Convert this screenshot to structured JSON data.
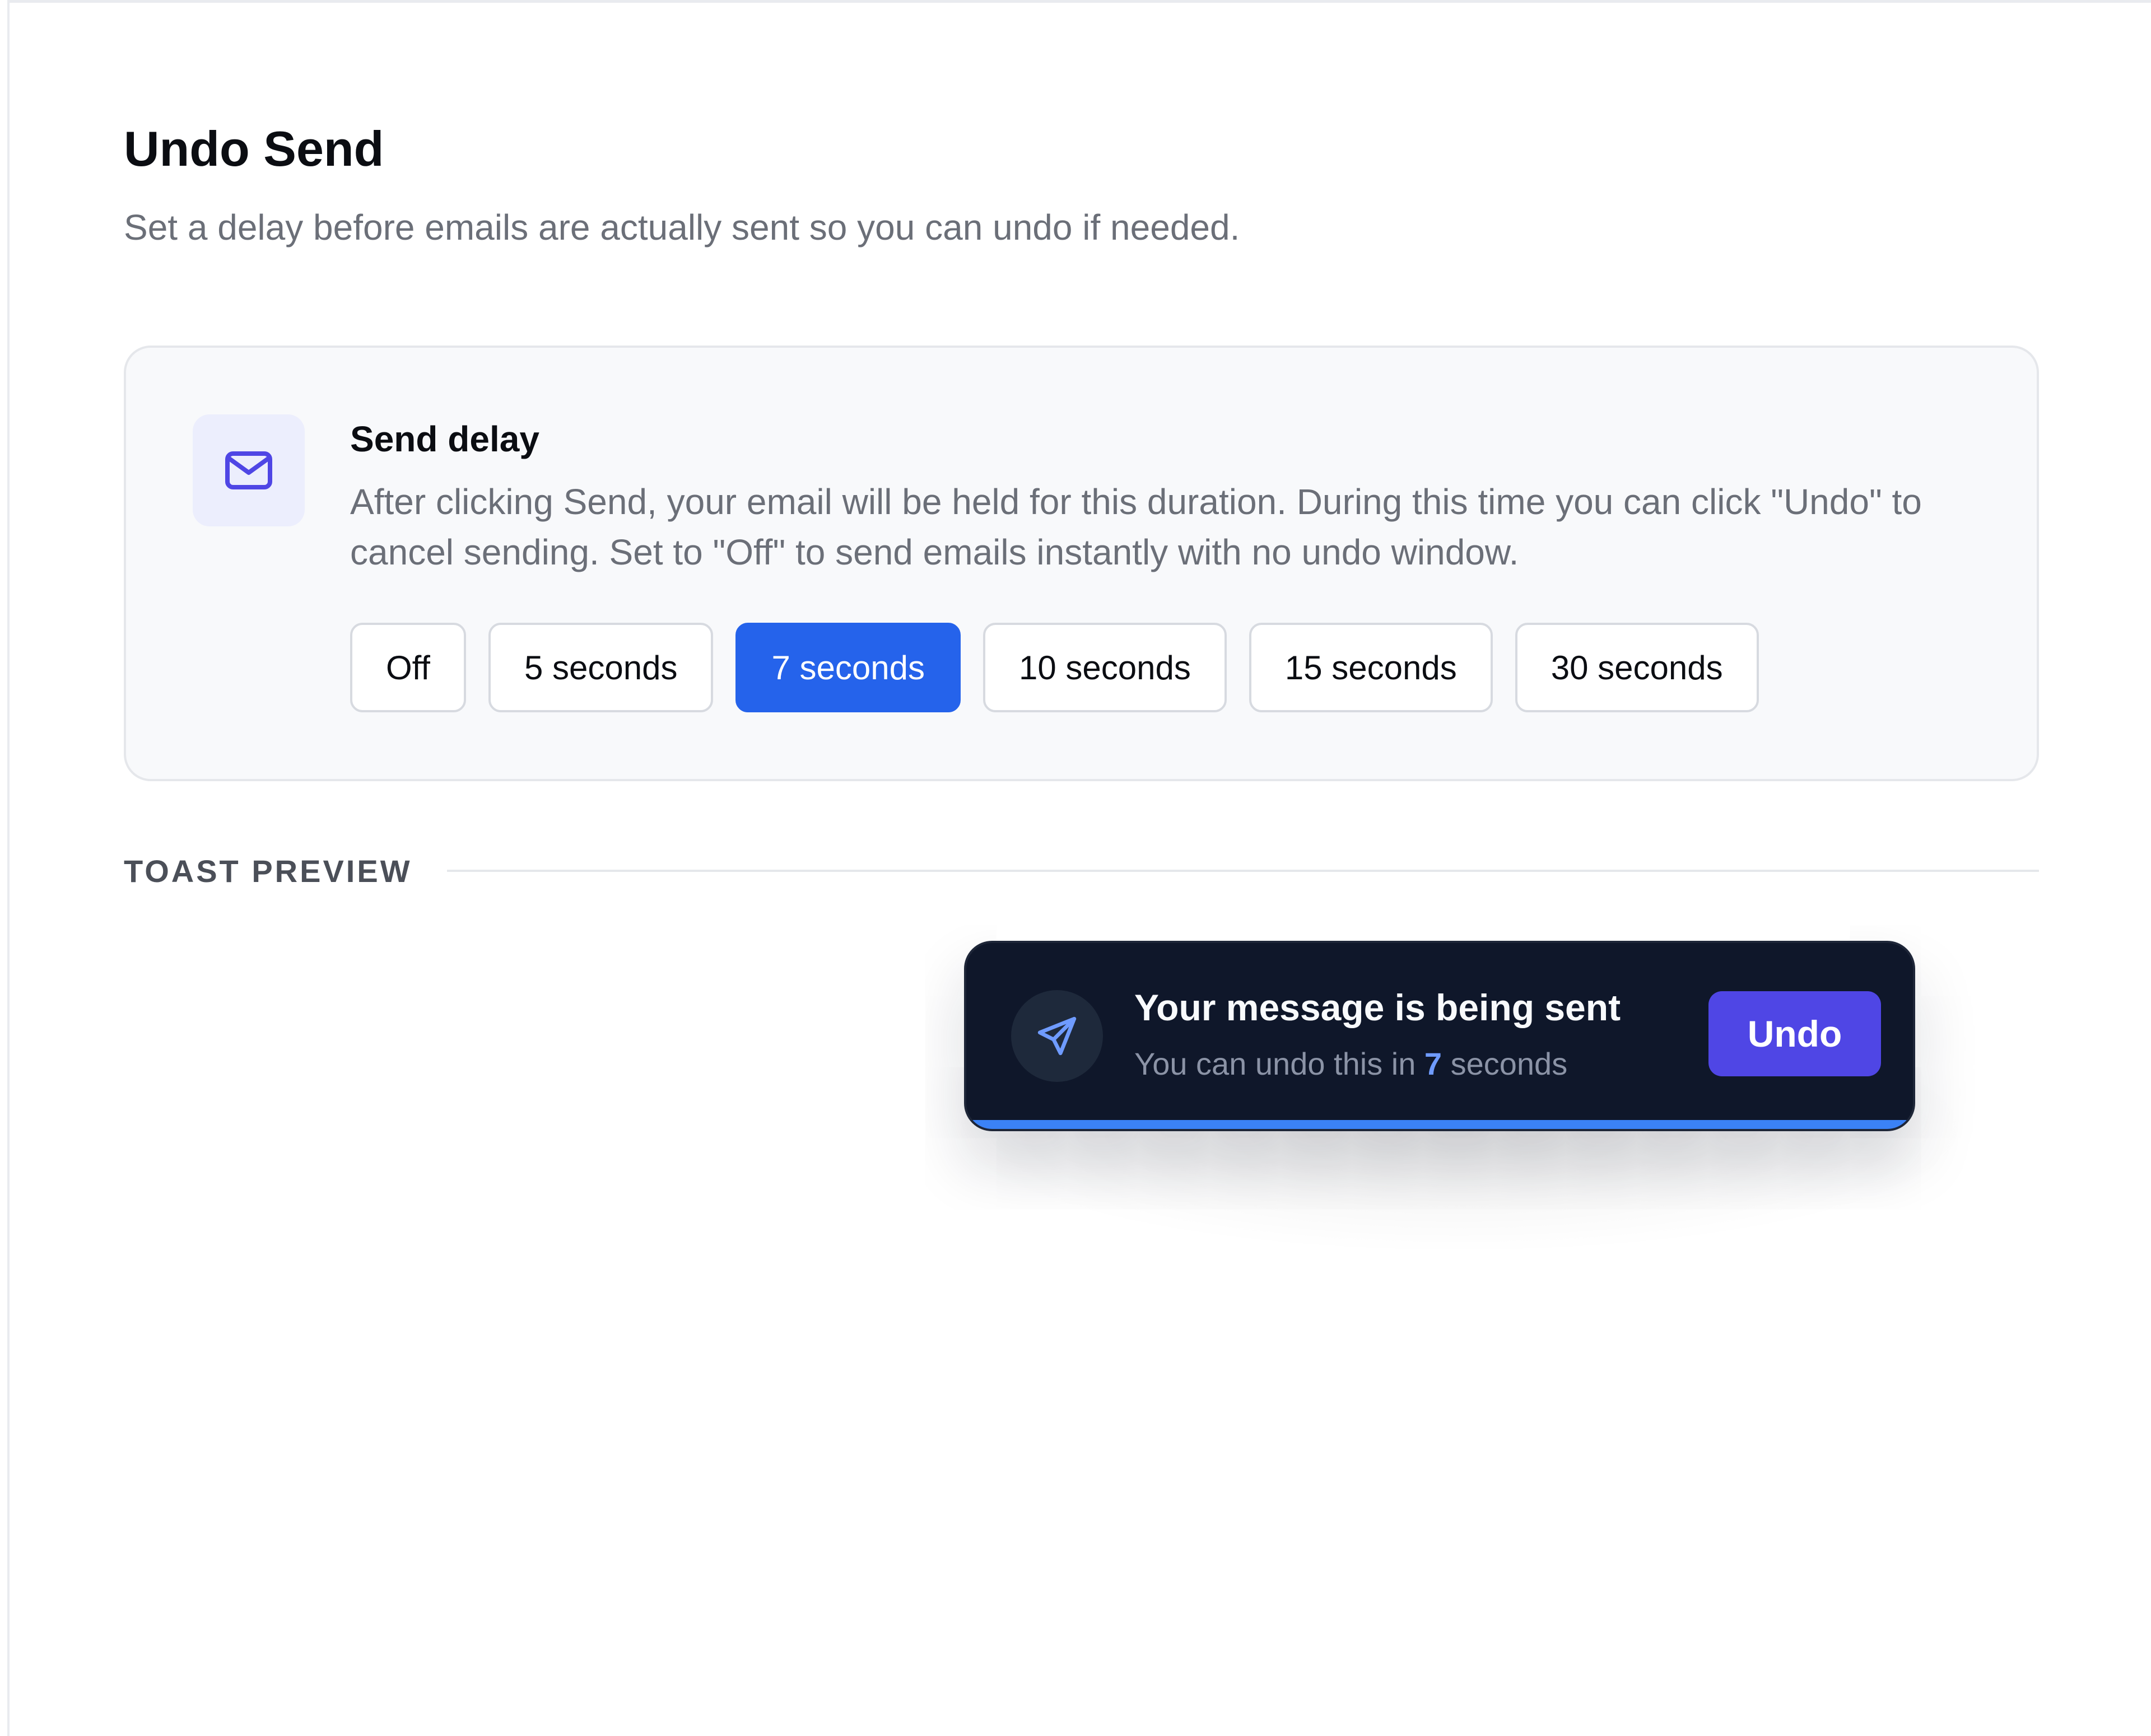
{
  "page": {
    "title": "Undo Send",
    "subtitle": "Set a delay before emails are actually sent so you can undo if needed."
  },
  "card": {
    "icon": "mail-icon",
    "title": "Send delay",
    "description": "After clicking Send, your email will be held for this duration. During this time you can click \"Undo\" to cancel sending. Set to \"Off\" to send emails instantly with no undo window.",
    "options": [
      {
        "label": "Off",
        "selected": false
      },
      {
        "label": "5 seconds",
        "selected": false
      },
      {
        "label": "7 seconds",
        "selected": true
      },
      {
        "label": "10 seconds",
        "selected": false
      },
      {
        "label": "15 seconds",
        "selected": false
      },
      {
        "label": "30 seconds",
        "selected": false
      }
    ]
  },
  "preview": {
    "section_label": "TOAST PREVIEW"
  },
  "toast": {
    "icon": "send-icon",
    "title": "Your message is being sent",
    "subtitle_prefix": "You can undo this in",
    "countdown": "7",
    "subtitle_suffix": "seconds",
    "undo_label": "Undo",
    "progress_percent": 100
  },
  "colors": {
    "accent": "#2563eb",
    "undo_button": "#4f46e5",
    "toast_background": "#0f172a",
    "progress": "#3b82f6"
  }
}
